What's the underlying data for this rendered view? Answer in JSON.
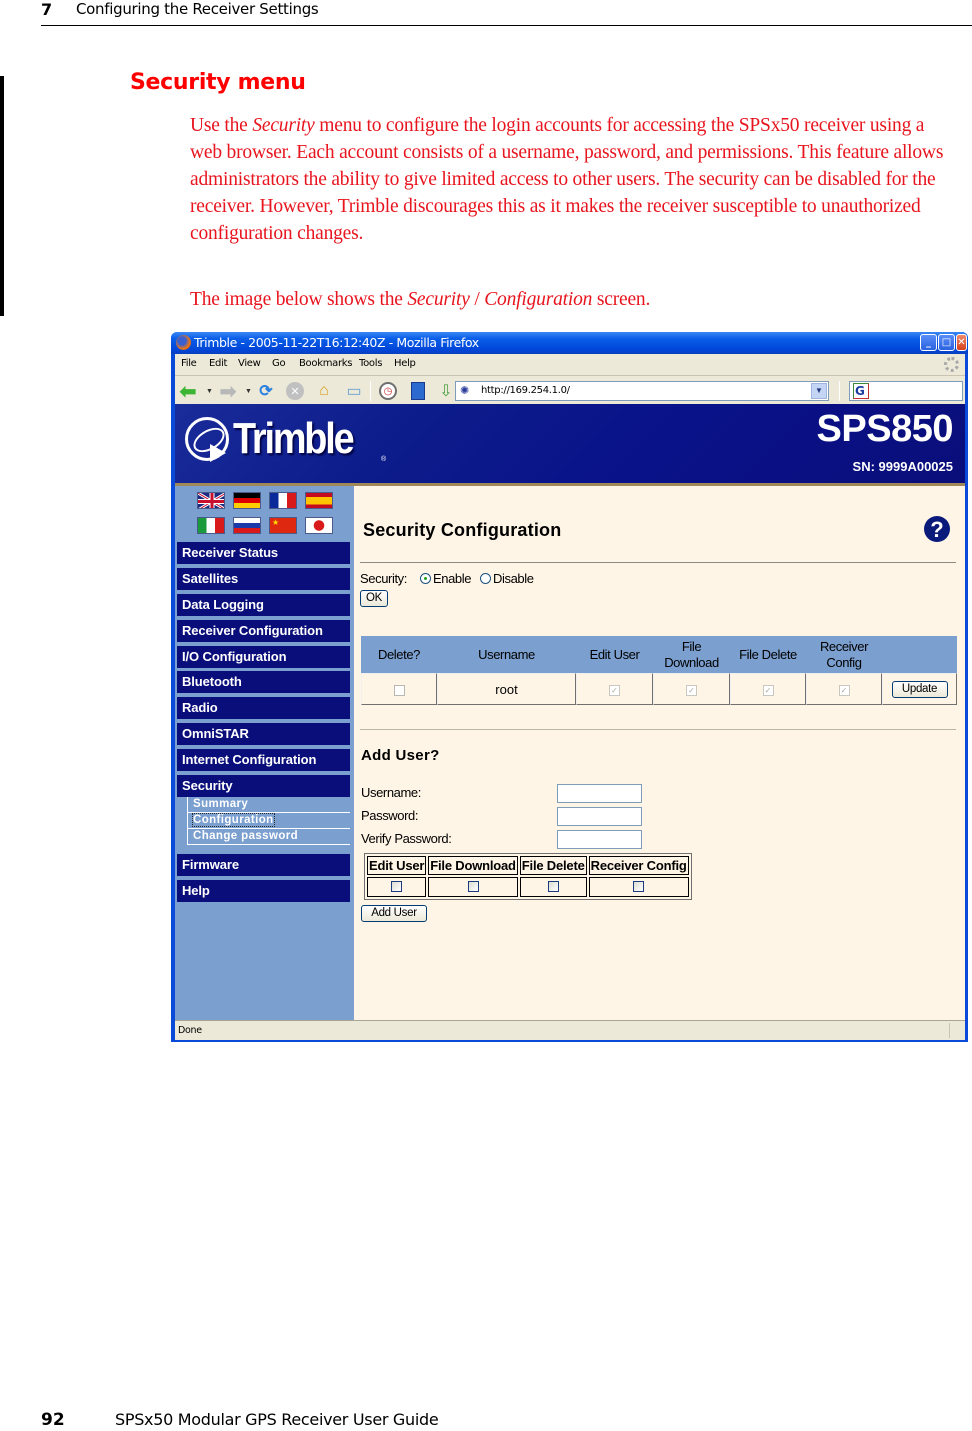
{
  "page_header": {
    "chapter_number": "7",
    "chapter_title": "Configuring the Receiver Settings"
  },
  "section": {
    "title": "Security menu",
    "paragraph1": {
      "before": "Use the ",
      "emphasis": "Security",
      "after": " menu to configure the login accounts for accessing the SPSx50 receiver using a web browser. Each account consists of a username, password, and permissions. This feature allows administrators the ability to give limited access to other users. The security can be disabled for the receiver. However, Trimble discourages this as it makes the receiver susceptible to unauthorized configuration changes."
    },
    "paragraph2": {
      "before": "The image below shows the ",
      "emphasis1": "Security",
      "separator": " / ",
      "emphasis2": "Configuration",
      "after": " screen."
    }
  },
  "browser": {
    "window_title": "Trimble - 2005-11-22T16:12:40Z - Mozilla Firefox",
    "menu": [
      "File",
      "Edit",
      "View",
      "Go",
      "Bookmarks",
      "Tools",
      "Help"
    ],
    "menu_access_keys": [
      "F",
      "E",
      "V",
      "G",
      "B",
      "T",
      "H"
    ],
    "url": "http://169.254.1.0/",
    "search_engine_icon": "G",
    "toolbar_icons": [
      "back-icon",
      "forward-icon",
      "reload-icon",
      "stop-icon",
      "home-icon",
      "new-tab-icon",
      "history-icon",
      "bookmarks-icon",
      "download-icon"
    ],
    "status": "Done"
  },
  "receiver_page": {
    "brand": "Trimble",
    "model": "SPS850",
    "serial": "SN: 9999A00025",
    "language_flags": [
      "English (UK)",
      "German",
      "French",
      "Spanish",
      "Italian",
      "Russian",
      "Chinese",
      "Japanese"
    ],
    "nav": [
      {
        "label": "Receiver Status"
      },
      {
        "label": "Satellites"
      },
      {
        "label": "Data Logging"
      },
      {
        "label": "Receiver Configuration"
      },
      {
        "label": "I/O Configuration"
      },
      {
        "label": "Bluetooth"
      },
      {
        "label": "Radio"
      },
      {
        "label": "OmniSTAR"
      },
      {
        "label": "Internet Configuration"
      },
      {
        "label": "Security"
      },
      {
        "label": "Firmware"
      },
      {
        "label": "Help"
      }
    ],
    "security_subnav": [
      {
        "label": "Summary",
        "active": false
      },
      {
        "label": "Configuration",
        "active": true
      },
      {
        "label": "Change password",
        "active": false
      }
    ],
    "title": "Security Configuration",
    "security_label": "Security:",
    "security_options": [
      "Enable",
      "Disable"
    ],
    "security_selected": "Enable",
    "ok_label": "OK",
    "users_table": {
      "headers": [
        "Delete?",
        "Username",
        "Edit User",
        "File Download",
        "File Delete",
        "Receiver Config"
      ],
      "rows": [
        {
          "delete": false,
          "username": "root",
          "edit_user": true,
          "file_download": true,
          "file_delete": true,
          "receiver_config": true,
          "action": "Update"
        }
      ]
    },
    "add_user": {
      "title": "Add User?",
      "username_label": "Username:",
      "password_label": "Password:",
      "verify_label": "Verify Password:",
      "username_value": "",
      "password_value": "",
      "verify_value": "",
      "permissions": [
        "Edit User",
        "File Download",
        "File Delete",
        "Receiver Config"
      ],
      "button": "Add User"
    }
  },
  "page_footer": {
    "page_number": "92",
    "guide_title": "SPSx50 Modular GPS Receiver User Guide"
  }
}
